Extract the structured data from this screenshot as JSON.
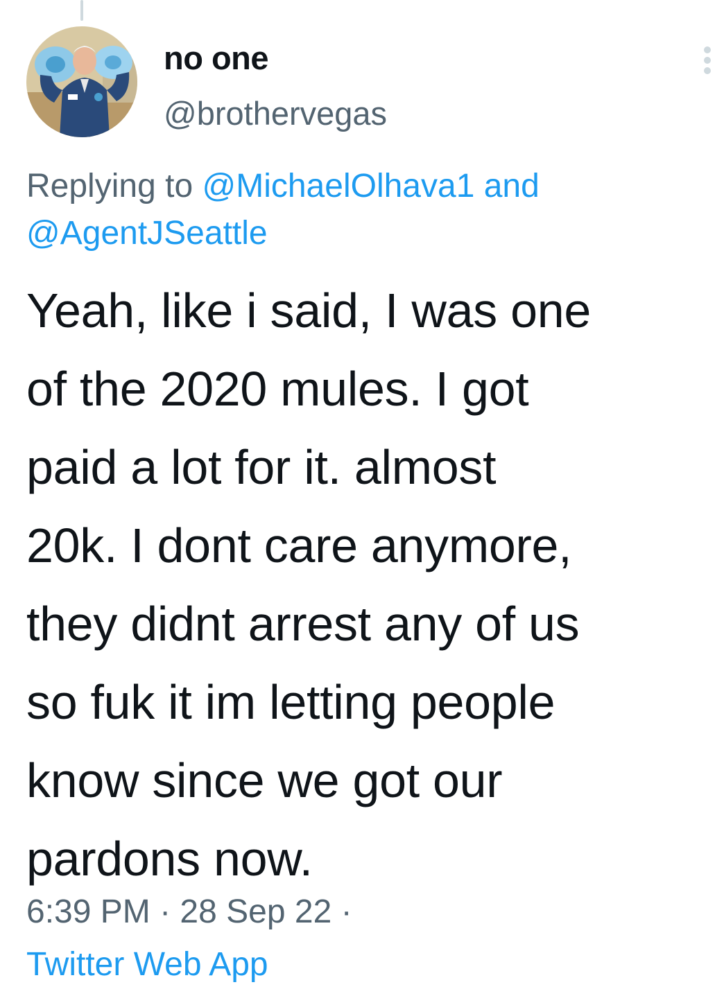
{
  "tweet": {
    "author": {
      "display_name": "no one",
      "handle": "@brothervegas",
      "avatar_icon": "profile-photo-avatar"
    },
    "more_icon": "vertical-ellipsis-icon",
    "reply_context": {
      "prefix": "Replying to ",
      "mentions": [
        "@MichaelOlhava1",
        "@AgentJSeattle"
      ],
      "conjunction": " and"
    },
    "text_lines": [
      "Yeah, like i said, I was one",
      "of the 2020 mules. I got",
      "paid a lot for it. almost",
      "20k. I dont care anymore,",
      "they didnt arrest any of us",
      "so fuk it im letting people",
      "know since we got our",
      "pardons now."
    ],
    "timestamp": "6:39 PM · 28 Sep 22 ·",
    "source": "Twitter Web App"
  },
  "colors": {
    "text_primary": "#0f1419",
    "text_secondary": "#536471",
    "link": "#1d9bf0",
    "thread_line": "#cfd9de"
  }
}
